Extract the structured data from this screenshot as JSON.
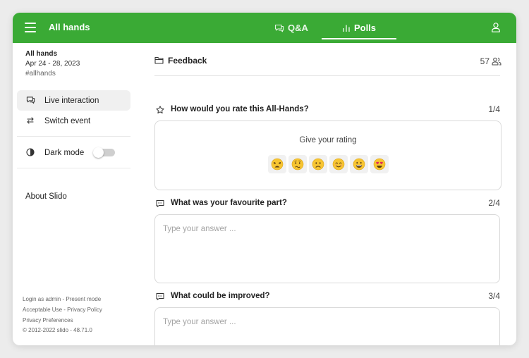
{
  "header": {
    "title": "All hands",
    "tabs": [
      {
        "label": "Q&A",
        "icon": "chat-bubbles-icon"
      },
      {
        "label": "Polls",
        "icon": "bar-chart-icon",
        "active": true
      }
    ]
  },
  "event": {
    "name": "All hands",
    "dates": "Apr 24 - 28, 2023",
    "hashtag": "#allhands"
  },
  "sidebar": {
    "items": [
      {
        "label": "Live interaction",
        "icon": "chat-bubbles-icon",
        "active": true
      },
      {
        "label": "Switch event",
        "icon": "switch-arrows-icon"
      },
      {
        "label": "Dark mode",
        "icon": "dark-mode-icon",
        "toggle": false
      },
      {
        "label": "About Slido"
      }
    ],
    "footer": {
      "login": "Login as admin",
      "present": "Present mode",
      "acceptable_use": "Acceptable Use",
      "privacy_policy": "Privacy Policy",
      "privacy_prefs": "Privacy Preferences",
      "copyright": "© 2012-2022 slido - 48.71.0",
      "sep": " - "
    }
  },
  "poll": {
    "title": "Feedback",
    "participants": "57",
    "questions": [
      {
        "text": "How would you rate this All-Hands?",
        "number": "1/4",
        "icon": "star-icon",
        "prompt": "Give your rating",
        "options": [
          "tired-face",
          "confused-face",
          "frowning-face",
          "smiling-face",
          "grinning-face",
          "heart-eyes-face"
        ]
      },
      {
        "text": "What was your favourite part?",
        "number": "2/4",
        "icon": "speech-bubble-icon",
        "placeholder": "Type your answer ..."
      },
      {
        "text": "What could be improved?",
        "number": "3/4",
        "icon": "speech-bubble-icon",
        "placeholder": "Type your answer ..."
      }
    ]
  },
  "colors": {
    "brand": "#3aaa35",
    "emoji_face": "#f7c531"
  }
}
